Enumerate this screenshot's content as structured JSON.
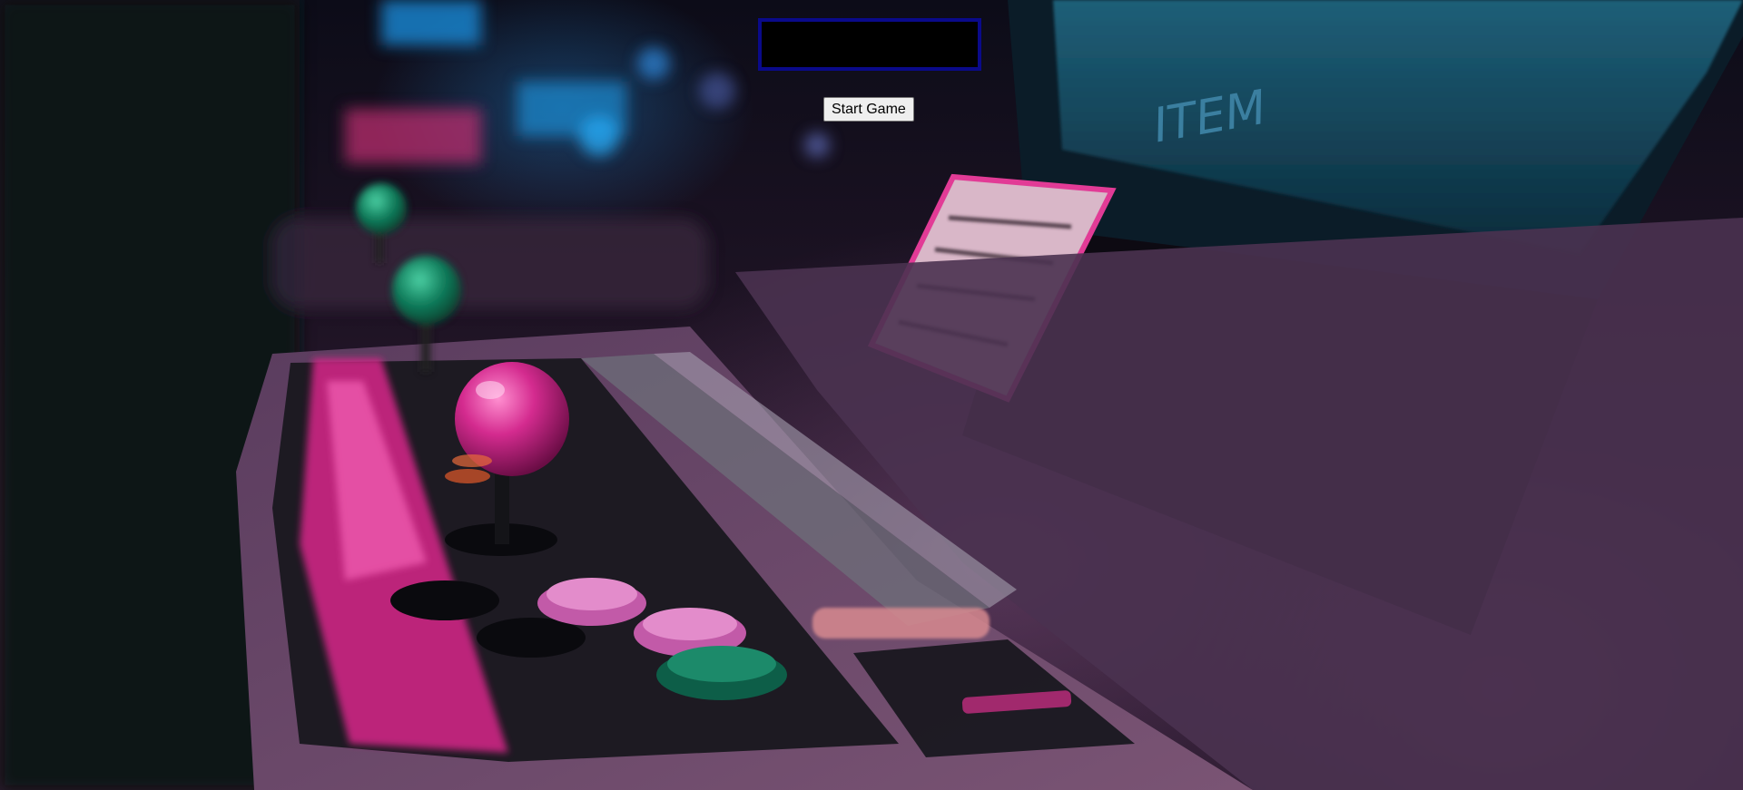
{
  "game": {
    "start_button_label": "Start Game",
    "cabinet_marquee_text": "ITEM"
  },
  "colors": {
    "canvas_background": "#000000",
    "canvas_border": "#0a0a8a",
    "joystick_pink": "#d42b8f",
    "button_pink": "#d866b8",
    "button_green": "#1c8a6a"
  }
}
